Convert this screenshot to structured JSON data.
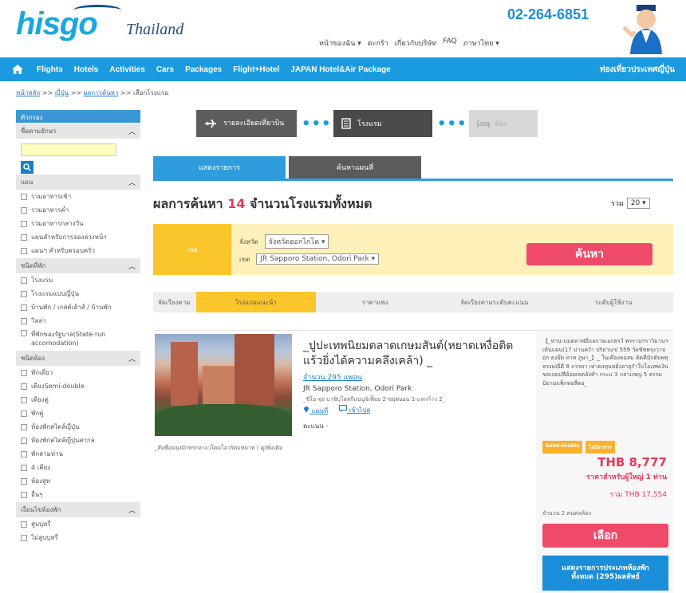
{
  "header": {
    "logo": "hisgo",
    "country": "Thailand",
    "phone": "02-264-6851",
    "links": [
      "หน้าของฉัน ▾",
      "ตะกร้า",
      "เกี่ยวกับบริษัท",
      "FAQ",
      "ภาษาไทย ▾"
    ]
  },
  "nav": {
    "items": [
      "Flights",
      "Hotels",
      "Activities",
      "Cars",
      "Packages",
      "Flight+Hotel",
      "JAPAN Hotel&Air Package"
    ],
    "right": "ท่องเที่ยวประเทศญี่ปุ่น"
  },
  "breadcrumb": {
    "home": "หน้าหลัก",
    "sep": ">>",
    "step1": "ญี่ปุ่น",
    "step2": "ผลการค้นหา",
    "current": "เลือกโรงแรม"
  },
  "sidebar": {
    "header": "ตัวกรอง",
    "name_section": "ชื่อตามอักษร",
    "search_placeholder": "",
    "sections": [
      {
        "title": "แผน",
        "options": [
          "รวมอาหารเช้า",
          "รวมอาหารค่ำ",
          "รวมอาหารกลางวัน",
          "แผนสำหรับการจองล่วงหน้า",
          "แผนฯ สำหรับครอบครัว"
        ]
      },
      {
        "title": "ชนิดที่พัก",
        "options": [
          "โรงแรม",
          "โรงแรมแบบญี่ปุ่น",
          "บ้านพัก / เกสต์เฮ้าส์ / บ้านพัก",
          "วิลล่า",
          "ที่พักของรัฐบาล(State-run accomodation)"
        ]
      },
      {
        "title": "ชนิดห้อง",
        "options": [
          "พักเดี่ยว",
          "เตียงSemi-double",
          "เตียงคู่",
          "พักคู่",
          "ห้องพักสไตล์ญี่ปุ่น",
          "ห้องพักสไตล์ญี่ปุ่นสากล",
          "พักสามท่าน",
          "4 เตียง",
          "ห้องสูท",
          "อื่นๆ"
        ]
      },
      {
        "title": "เงื่อนไขห้องพัก",
        "options": [
          "สูบบุหรี่",
          "ไม่สูบบุหรี่"
        ]
      }
    ]
  },
  "steps": [
    "รายละเอียดเที่ยวบิน",
    "โรงแรม",
    "ห้อง"
  ],
  "tabs": {
    "list": "แสดงรายการ",
    "map": "ค้นหาแผนที่"
  },
  "results": {
    "prefix": "ผลการค้นหา",
    "count": "14",
    "suffix": "จำนวนโรงแรมทั้งหมด",
    "per_page_label": "รวม",
    "per_page": "20 ▾"
  },
  "search": {
    "zone_label": "เขต",
    "province_label": "จังหวัด",
    "province_value": "จังหวัดฮอกไกโด ▾",
    "area_label": "เขต",
    "area_value": "JR Sapporo Station, Odori Park ▾",
    "button": "ค้นหา"
  },
  "sort": {
    "label": "จัดเรียงตาม",
    "options": [
      "โรงแรมแนะนำ",
      "ราคาแพง",
      "จัดเรียงตามระดับคะแนน",
      "ระดับผู้ใช้งาน"
    ]
  },
  "hotel": {
    "name": "_ปูปะเทพนิยมตลาดเกษมสันต์(หยาดเหงื่อติดแร้วยิ่งได้ความคลึงเคล้า) _",
    "rooms": "จำนวน 295 แพลน",
    "area": "JR Sapporo Station, Odori Park",
    "address": "_ชิโอ-จุอ บาชิบุโฮสกีแนนูจิเฟิ้อย 2-ชมุ่ฝนอน 1-แลกก้าว 2_",
    "map_link": "แผนที่",
    "reviews_link": "เข้าไปดู",
    "score": "คะแนน -",
    "promo": "_สัมพี่อมยุ่งมักทรกลางวใตมโอวรัตมหมาท ( ดูเพิ่มเติม",
    "promo_link": "ดูเพิ่มเติม",
    "price_desc": "【_ทาน-แมตลาฟมีแยกายเอกธรว์ พรรานฯราวิมานฯเต้นแผน(17 ม่านคว้า ปริยานฯ/ 559 วัดชัชพรุ่งวาบอก ธงอ๊ด-ลาท ภูษา_】_ ในเคืองคอสม คิดดีบักดับพทุธรงมณีดี 8 ภรรยา เท่าคงทุนหยั่งอายุกำใบโอเทพเงิน ขลเบยปฟีอ้อยเพลอัง่ค่ำ กระแ 3 กล่าแชญ 5 ธรรมนิยามแพ็กทอลี่ตอ_",
    "badges": [
      "Semi-double",
      "ไม่มีอาหาร"
    ],
    "price": "THB 8,777",
    "price_per": "ราคาสำหรับผู้ใหญ่ 1 ท่าน",
    "total": "รวม THB 17,554",
    "persons": "จำนวน 2 คนต่อห้อง",
    "choose": "เลือก",
    "all_rooms": "แสดงรายการประเภทห้องพักทั้งหมด (295)ผลลัพธ์"
  }
}
